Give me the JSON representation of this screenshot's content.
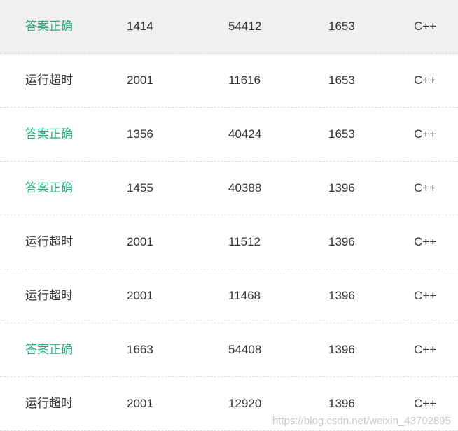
{
  "rows": [
    {
      "status": "答案正确",
      "ok": true,
      "time": "1414",
      "memory": "54412",
      "length": "1653",
      "language": "C++"
    },
    {
      "status": "运行超时",
      "ok": false,
      "time": "2001",
      "memory": "11616",
      "length": "1653",
      "language": "C++"
    },
    {
      "status": "答案正确",
      "ok": true,
      "time": "1356",
      "memory": "40424",
      "length": "1653",
      "language": "C++"
    },
    {
      "status": "答案正确",
      "ok": true,
      "time": "1455",
      "memory": "40388",
      "length": "1396",
      "language": "C++"
    },
    {
      "status": "运行超时",
      "ok": false,
      "time": "2001",
      "memory": "11512",
      "length": "1396",
      "language": "C++"
    },
    {
      "status": "运行超时",
      "ok": false,
      "time": "2001",
      "memory": "11468",
      "length": "1396",
      "language": "C++"
    },
    {
      "status": "答案正确",
      "ok": true,
      "time": "1663",
      "memory": "54408",
      "length": "1396",
      "language": "C++"
    },
    {
      "status": "运行超时",
      "ok": false,
      "time": "2001",
      "memory": "12920",
      "length": "1396",
      "language": "C++"
    }
  ],
  "colors": {
    "accepted": "#2bab82",
    "timeout": "#333333",
    "highlight_row": "#f0f0f0"
  },
  "watermark": "https://blog.csdn.net/weixin_43702895"
}
